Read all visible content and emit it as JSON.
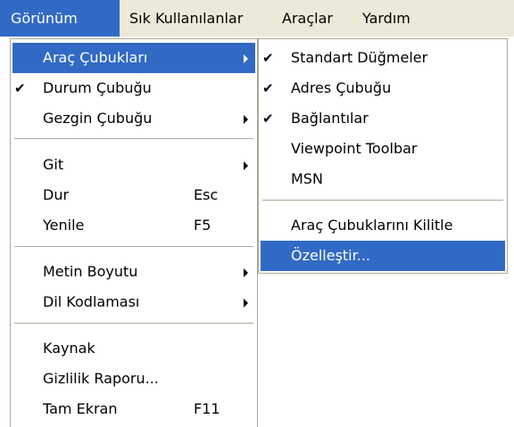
{
  "menubar": {
    "items": [
      "Görünüm",
      "Sık Kullanılanlar",
      "Araçlar",
      "Yardım"
    ]
  },
  "main_menu": {
    "items": [
      {
        "label": "Araç Çubukları",
        "checked": false,
        "shortcut": "",
        "submenu": true
      },
      {
        "label": "Durum Çubuğu",
        "checked": true,
        "shortcut": "",
        "submenu": false
      },
      {
        "label": "Gezgin Çubuğu",
        "checked": false,
        "shortcut": "",
        "submenu": true
      },
      {
        "label": "Git",
        "checked": false,
        "shortcut": "",
        "submenu": true
      },
      {
        "label": "Dur",
        "checked": false,
        "shortcut": "Esc",
        "submenu": false
      },
      {
        "label": "Yenile",
        "checked": false,
        "shortcut": "F5",
        "submenu": false
      },
      {
        "label": "Metin Boyutu",
        "checked": false,
        "shortcut": "",
        "submenu": true
      },
      {
        "label": "Dil Kodlaması",
        "checked": false,
        "shortcut": "",
        "submenu": true
      },
      {
        "label": "Kaynak",
        "checked": false,
        "shortcut": "",
        "submenu": false
      },
      {
        "label": "Gizlilik Raporu...",
        "checked": false,
        "shortcut": "",
        "submenu": false
      },
      {
        "label": "Tam Ekran",
        "checked": false,
        "shortcut": "F11",
        "submenu": false
      }
    ]
  },
  "sub_menu": {
    "items": [
      {
        "label": "Standart Düğmeler",
        "checked": true
      },
      {
        "label": "Adres Çubuğu",
        "checked": true
      },
      {
        "label": "Bağlantılar",
        "checked": true
      },
      {
        "label": "Viewpoint Toolbar",
        "checked": false
      },
      {
        "label": "MSN",
        "checked": false
      },
      {
        "label": "Araç Çubuklarını Kilitle",
        "checked": false
      },
      {
        "label": "Özelleştir...",
        "checked": false
      }
    ]
  },
  "colors": {
    "menubar_bg": "#ece9d8",
    "highlight": "#316ac5",
    "menu_border": "#aca899"
  },
  "icons": {
    "check": "check-icon",
    "arrow": "chevron-right-icon"
  }
}
